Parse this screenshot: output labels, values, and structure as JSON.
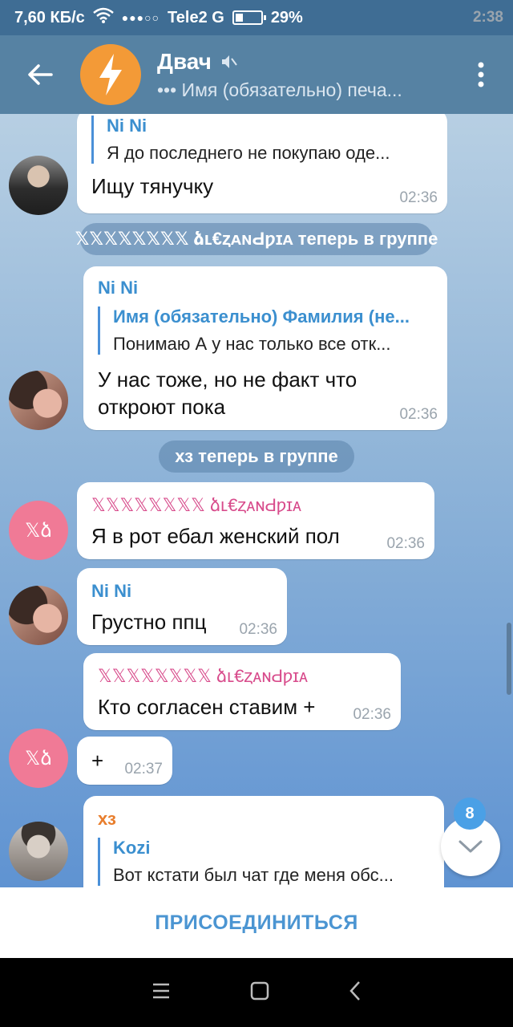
{
  "status": {
    "time": "2:38",
    "speed": "7,60 КБ/с",
    "carrier": "Tele2 G",
    "battery": "29%",
    "battery_level": 0.29
  },
  "header": {
    "title": "Двач",
    "subtitle": "••• Имя (обязательно) печа..."
  },
  "messages": [
    {
      "reply_name": "Ni Ni",
      "reply_text": "Я до последнего не покупаю оде...",
      "text": "Ищу тянучку",
      "time": "02:36"
    },
    {
      "service": "𝕏𝕏𝕏𝕏𝕏𝕏𝕏𝕏 ձʟ€ȥᴀɴԀƿɪᴀ теперь в группе"
    },
    {
      "sender": "Ni Ni",
      "reply_name": "Имя (обязательно) Фамилия (не...",
      "reply_text": "Понимаю А у нас только все отк...",
      "text_line1": "У нас тоже, но не факт что",
      "text_line2": "откроют пока",
      "time": "02:36"
    },
    {
      "service": "хз теперь в группе"
    },
    {
      "sender": "𝕏𝕏𝕏𝕏𝕏𝕏𝕏𝕏 ձʟ€ȥᴀɴԀƿɪᴀ",
      "text": "Я в рот ебал женский пол",
      "time": "02:36"
    },
    {
      "sender": "Ni Ni",
      "text": "Грустно ппц",
      "time": "02:36"
    },
    {
      "sender": "𝕏𝕏𝕏𝕏𝕏𝕏𝕏𝕏 ձʟ€ȥᴀɴԀƿɪᴀ",
      "text": "Кто согласен ставим +",
      "time": "02:36"
    },
    {
      "text": "+",
      "time": "02:37"
    },
    {
      "sender": "хз",
      "reply_name": "Kozi",
      "reply_text": "Вот кстати был чат где меня обс..."
    }
  ],
  "avatar_pink_text": "𝕏ձ",
  "unread_count": "8",
  "join_label": "ПРИСОЕДИНИТЬСЯ",
  "colors": {
    "header": "#5682a3",
    "accent": "#4b95d2",
    "pink_avatar": "#f07a96",
    "chat_avatar": "#f39a37"
  }
}
